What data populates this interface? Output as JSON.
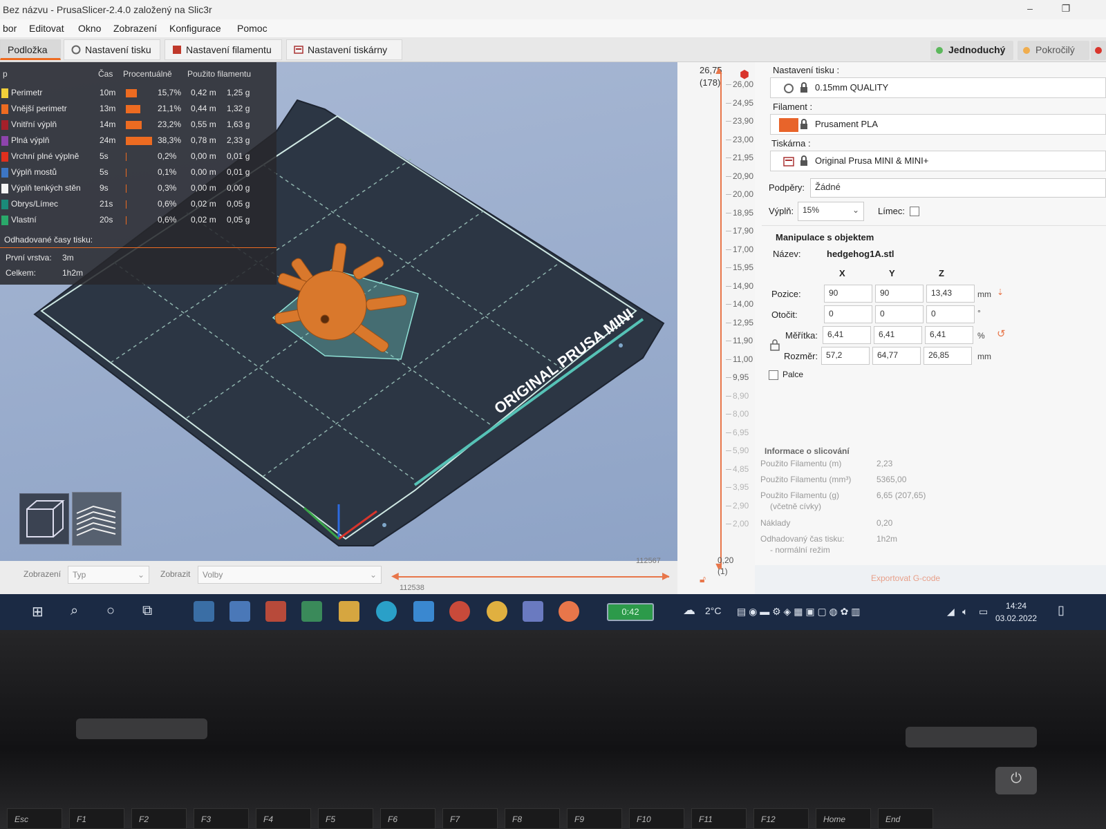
{
  "window": {
    "title": "Bez názvu - PrusaSlicer-2.4.0 založený na Slic3r",
    "minimize_icon": "minimize-icon",
    "maximize_icon": "maximize-icon"
  },
  "menu": [
    "bor",
    "Editovat",
    "Okno",
    "Zobrazení",
    "Konfigurace",
    "Pomoc"
  ],
  "tabs": [
    {
      "label": "Podložka",
      "active": true
    },
    {
      "label": "Nastavení tisku",
      "icon": "print-settings-icon"
    },
    {
      "label": "Nastavení filamentu",
      "icon": "filament-icon"
    },
    {
      "label": "Nastavení tiskárny",
      "icon": "printer-icon"
    }
  ],
  "modes": [
    {
      "label": "Jednoduchý",
      "color": "#5cb85c"
    },
    {
      "label": "Pokročilý",
      "color": "#f0ad4e"
    }
  ],
  "legend": {
    "headers": [
      "p",
      "Čas",
      "Procentuálně",
      "Použito filamentu"
    ],
    "rows": [
      {
        "name": "Perimetr",
        "color": "#f2d03a",
        "time": "10m",
        "pct": "15,7%",
        "bar": 0.157,
        "len": "0,42 m",
        "weight": "1,25 g"
      },
      {
        "name": "Vnější perimetr",
        "color": "#ed6b21",
        "time": "13m",
        "pct": "21,1%",
        "bar": 0.211,
        "len": "0,44 m",
        "weight": "1,32 g"
      },
      {
        "name": "Vnitřní výplň",
        "color": "#a5202a",
        "time": "14m",
        "pct": "23,2%",
        "bar": 0.232,
        "len": "0,55 m",
        "weight": "1,63 g"
      },
      {
        "name": "Plná výplň",
        "color": "#8e44ad",
        "time": "24m",
        "pct": "38,3%",
        "bar": 0.383,
        "len": "0,78 m",
        "weight": "2,33 g"
      },
      {
        "name": "Vrchní plné výplně",
        "color": "#e0301e",
        "time": "5s",
        "pct": "0,2%",
        "bar": 0.002,
        "len": "0,00 m",
        "weight": "0,01 g"
      },
      {
        "name": "Výplň mostů",
        "color": "#3d76c5",
        "time": "5s",
        "pct": "0,1%",
        "bar": 0.001,
        "len": "0,00 m",
        "weight": "0,01 g"
      },
      {
        "name": "Výplň tenkých stěn",
        "color": "#f5f5f5",
        "time": "9s",
        "pct": "0,3%",
        "bar": 0.003,
        "len": "0,00 m",
        "weight": "0,00 g"
      },
      {
        "name": "Obrys/Límec",
        "color": "#1a8a7a",
        "time": "21s",
        "pct": "0,6%",
        "bar": 0.006,
        "len": "0,02 m",
        "weight": "0,05 g"
      },
      {
        "name": "Vlastní",
        "color": "#2aa86a",
        "time": "20s",
        "pct": "0,6%",
        "bar": 0.006,
        "len": "0,02 m",
        "weight": "0,05 g"
      }
    ],
    "estimated_label": "Odhadované časy tisku:",
    "first_layer_label": "První vrstva:",
    "first_layer_value": "3m",
    "total_label": "Celkem:",
    "total_value": "1h2m"
  },
  "bed": {
    "logo_text": "ORIGINAL PRUSA MINI"
  },
  "bottom": {
    "view_label": "Zobrazení",
    "view_value": "Typ",
    "show_label": "Zobrazit",
    "show_value": "Volby",
    "hslider_top": "112567",
    "hslider_bottom": "112538"
  },
  "vslider": {
    "top_value": "26,75",
    "top_layer": "(178)",
    "bottom_value": "0,20",
    "bottom_layer": "(1)",
    "ticks": [
      "26,00",
      "24,95",
      "23,90",
      "23,00",
      "21,95",
      "20,90",
      "20,00",
      "18,95",
      "17,90",
      "17,00",
      "15,95",
      "14,90",
      "14,00",
      "12,95",
      "11,90",
      "11,00",
      "9,95",
      "8,90",
      "8,00",
      "6,95",
      "5,90",
      "4,85",
      "3,95",
      "2,90",
      "2,00"
    ]
  },
  "panel": {
    "print_label": "Nastavení tisku :",
    "print_value": "0.15mm QUALITY",
    "filament_label": "Filament :",
    "filament_value": "Prusament PLA",
    "filament_color": "#e8642a",
    "printer_label": "Tiskárna :",
    "printer_value": "Original Prusa MINI & MINI+",
    "supports_label": "Podpěry:",
    "supports_value": "Žádné",
    "infill_label": "Výplň:",
    "infill_value": "15%",
    "brim_label": "Límec:",
    "manip_title": "Manipulace s objektem",
    "name_label": "Název:",
    "name_value": "hedgehog1A.stl",
    "axes": [
      "X",
      "Y",
      "Z"
    ],
    "position_label": "Pozice:",
    "position": [
      "90",
      "90",
      "13,43"
    ],
    "position_unit": "mm",
    "rotate_label": "Otočit:",
    "rotate": [
      "0",
      "0",
      "0"
    ],
    "rotate_unit": "°",
    "scale_label": "Měřítka:",
    "scale": [
      "6,41",
      "6,41",
      "6,41"
    ],
    "scale_unit": "%",
    "size_label": "Rozměr:",
    "size": [
      "57,2",
      "64,77",
      "26,85"
    ],
    "size_unit": "mm",
    "inches_label": "Palce",
    "info_title": "Informace o slicování",
    "info": [
      {
        "label": "Použito Filamentu (m)",
        "sub": "",
        "value": "2,23"
      },
      {
        "label": "Použito Filamentu (mm³)",
        "sub": "",
        "value": "5365,00"
      },
      {
        "label": "Použito Filamentu (g)",
        "sub": "(včetně cívky)",
        "value": "6,65 (207,65)"
      },
      {
        "label": "Náklady",
        "sub": "",
        "value": "0,20"
      },
      {
        "label": "Odhadovaný čas tisku:",
        "sub": "- normální režim",
        "value": "1h2m"
      }
    ],
    "export_label": "Exportovat G-code"
  },
  "taskbar": {
    "battery": "0:42",
    "weather": "2°C",
    "time": "14:24",
    "date": "03.02.2022"
  },
  "keyboard": {
    "fkeys": [
      "Esc",
      "F1",
      "F2",
      "F3",
      "F4",
      "F5",
      "F6",
      "F7",
      "F8",
      "F9",
      "F10",
      "F11",
      "F12",
      "Home",
      "End"
    ]
  },
  "colors": {
    "accent": "#ed6b21",
    "bed": "#2c3644",
    "model": "#d9782c"
  }
}
